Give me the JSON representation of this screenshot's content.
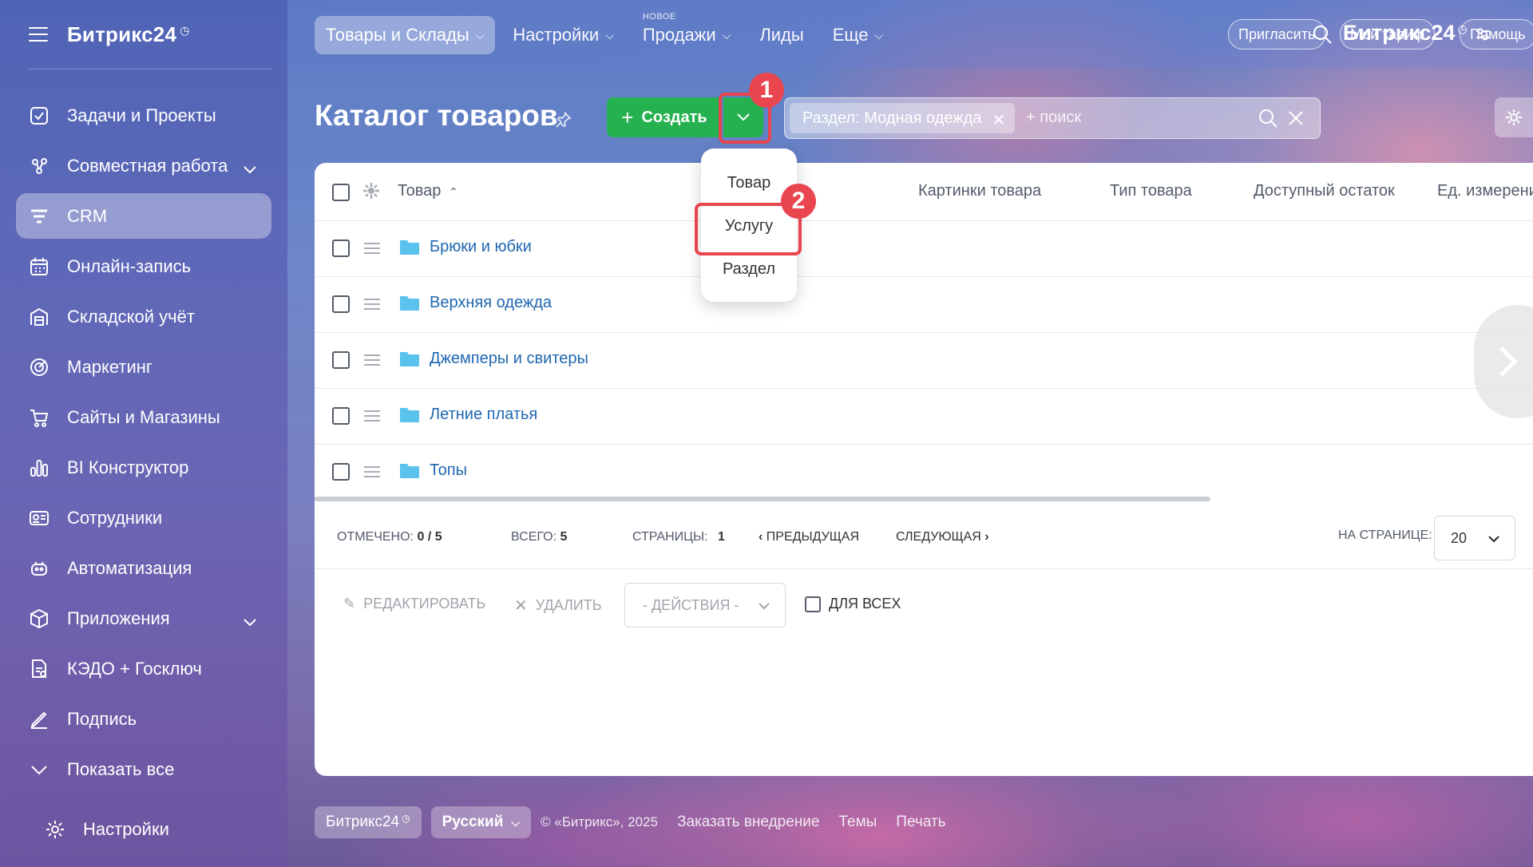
{
  "sidebar": {
    "logo": "Битрикс24",
    "items": [
      {
        "label": "Задачи и Проекты"
      },
      {
        "label": "Совместная работа"
      },
      {
        "label": "CRM"
      },
      {
        "label": "Онлайн-запись"
      },
      {
        "label": "Складской учёт"
      },
      {
        "label": "Маркетинг"
      },
      {
        "label": "Сайты и Магазины"
      },
      {
        "label": "BI Конструктор"
      },
      {
        "label": "Сотрудники"
      },
      {
        "label": "Автоматизация"
      },
      {
        "label": "Приложения"
      },
      {
        "label": "КЭДО + Госключ"
      },
      {
        "label": "Подпись"
      },
      {
        "label": "Показать все"
      }
    ],
    "settings_label": "Настройки"
  },
  "topbar": {
    "nav": [
      {
        "label": "Товары и Склады"
      },
      {
        "label": "Настройки"
      },
      {
        "label": "Продажи",
        "badge": "НОВОЕ"
      },
      {
        "label": "Лиды"
      },
      {
        "label": "Еще"
      }
    ],
    "logo": "Битрикс24",
    "invite_label": "Пригласить",
    "tariff_label": "Мой тариф",
    "help_label": "Помощь"
  },
  "page": {
    "title": "Каталог товаров",
    "create_label": "Создать",
    "filter_chip": "Раздел: Модная одежда",
    "search_placeholder": "+ поиск"
  },
  "annotations": {
    "step1": "1",
    "step2": "2"
  },
  "create_menu": {
    "items": [
      {
        "label": "Товар"
      },
      {
        "label": "Услугу"
      },
      {
        "label": "Раздел"
      }
    ]
  },
  "table": {
    "columns": [
      "Товар",
      "Картинки товара",
      "Тип товара",
      "Доступный остаток",
      "Ед. измерени"
    ],
    "rows": [
      {
        "name": "Брюки и юбки"
      },
      {
        "name": "Верхняя одежда"
      },
      {
        "name": "Джемперы и свитеры"
      },
      {
        "name": "Летние платья"
      },
      {
        "name": "Топы"
      }
    ]
  },
  "pager": {
    "checked_label": "ОТМЕЧЕНО:",
    "checked_value": "0 / 5",
    "total_label": "ВСЕГО:",
    "total_value": "5",
    "pages_label": "СТРАНИЦЫ:",
    "pages_value": "1",
    "prev_label": "ПРЕДЫДУЩАЯ",
    "next_label": "СЛЕДУЮЩАЯ",
    "per_page_label": "НА СТРАНИЦЕ:",
    "per_page_value": "20"
  },
  "actions": {
    "edit_label": "РЕДАКТИРОВАТЬ",
    "delete_label": "УДАЛИТЬ",
    "actions_placeholder": "- ДЕЙСТВИЯ -",
    "for_all_label": "ДЛЯ ВСЕХ"
  },
  "footer": {
    "brand": "Битрикс24",
    "language": "Русский",
    "copyright": "© «Битрикс», 2025",
    "links": [
      "Заказать внедрение",
      "Темы",
      "Печать"
    ]
  },
  "colors": {
    "accent_green": "#26b150",
    "highlight_red": "#e8454f",
    "link_blue": "#2067b0"
  }
}
